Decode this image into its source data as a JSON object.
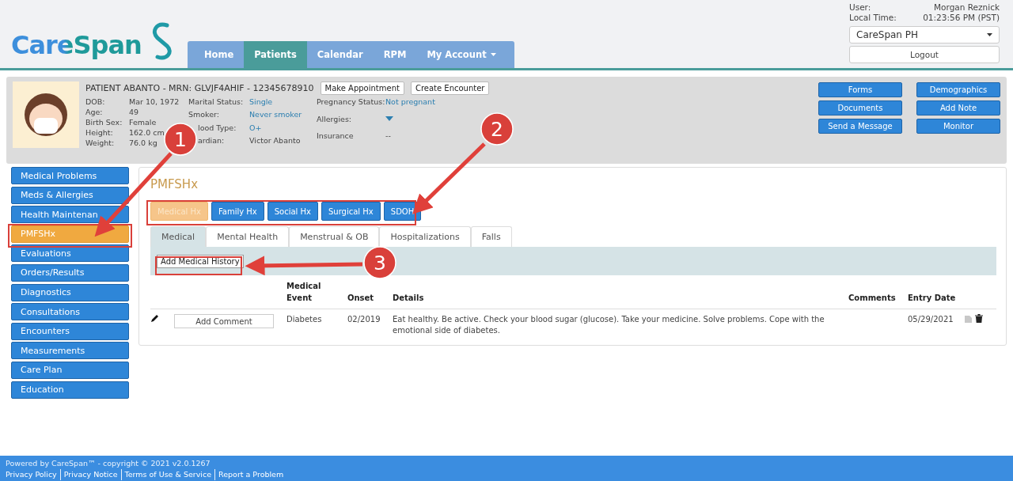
{
  "header": {
    "logo": "CareSpan",
    "nav": [
      {
        "label": "Home",
        "selected": false
      },
      {
        "label": "Patients",
        "selected": true
      },
      {
        "label": "Calendar",
        "selected": false
      },
      {
        "label": "RPM",
        "selected": false
      },
      {
        "label": "My Account",
        "selected": false,
        "kind": "menu"
      }
    ],
    "user_label": "User:",
    "user": "Morgan Reznick",
    "time_label": "Local Time:",
    "time": "01:23:56 PM (PST)",
    "org": "CareSpan PH",
    "logout": "Logout"
  },
  "patient": {
    "title": "PATIENT ABANTO - MRN: GLVJF4AHIF - 12345678910",
    "buttons": [
      "Make Appointment",
      "Create Encounter"
    ],
    "columns": [
      [
        {
          "label": "DOB:",
          "value": "Mar 10, 1972"
        },
        {
          "label": "Age:",
          "value": "49"
        },
        {
          "label": "Birth Sex:",
          "value": "Female"
        },
        {
          "label": "Height:",
          "value": "162.0 cm"
        },
        {
          "label": "Weight:",
          "value": "76.0 kg"
        }
      ],
      [
        {
          "label": "Marital Status:",
          "value": "Single",
          "kind": "link"
        },
        {
          "label": "Smoker:",
          "value": "Never smoker",
          "kind": "link"
        },
        {
          "label": "lood Type:",
          "value": "O+",
          "kind": "link",
          "covered": true
        },
        {
          "label": "ardian:",
          "value": "Victor Abanto",
          "covered": true
        }
      ],
      [
        {
          "label": "Pregnancy Status:",
          "value": "Not pregnant",
          "kind": "link"
        },
        {
          "label": "Allergies:",
          "kind": "caret"
        },
        {
          "label": "Insurance",
          "value": "--"
        }
      ]
    ],
    "actions": [
      [
        "Forms",
        "Demographics"
      ],
      [
        "Documents",
        "Add Note"
      ],
      [
        "Send a Message",
        "Monitor"
      ]
    ]
  },
  "sidebar": {
    "items": [
      {
        "label": "Medical Problems",
        "selected": false
      },
      {
        "label": "Meds & Allergies",
        "selected": false
      },
      {
        "label": "Health Maintenan",
        "selected": false
      },
      {
        "label": "PMFSHx",
        "selected": true
      },
      {
        "label": "Evaluations",
        "selected": false
      },
      {
        "label": "Orders/Results",
        "selected": false
      },
      {
        "label": "Diagnostics",
        "selected": false
      },
      {
        "label": "Consultations",
        "selected": false
      },
      {
        "label": "Encounters",
        "selected": false
      },
      {
        "label": "Measurements",
        "selected": false
      },
      {
        "label": "Care Plan",
        "selected": false
      },
      {
        "label": "Education",
        "selected": false
      }
    ]
  },
  "content": {
    "title": "PMFSHx",
    "tabs": [
      {
        "label": "Medical Hx",
        "selected": true
      },
      {
        "label": "Family Hx",
        "selected": false
      },
      {
        "label": "Social Hx",
        "selected": false
      },
      {
        "label": "Surgical Hx",
        "selected": false
      },
      {
        "label": "SDOH",
        "selected": false
      }
    ],
    "subtabs": [
      {
        "label": "Medical",
        "selected": true
      },
      {
        "label": "Mental Health",
        "selected": false
      },
      {
        "label": "Menstrual & OB",
        "selected": false
      },
      {
        "label": "Hospitalizations",
        "selected": false
      },
      {
        "label": "Falls",
        "selected": false
      }
    ],
    "add_button": "Add Medical History",
    "table": {
      "columns": [
        "Medical Event",
        "Onset",
        "Details",
        "Comments",
        "Entry Date"
      ],
      "rows": [
        {
          "comment_button": "Add Comment",
          "event": "Diabetes",
          "onset": "02/2019",
          "details": "Eat healthy. Be active. Check your blood sugar (glucose). Take your medicine. Solve problems. Cope with the emotional side of diabetes.",
          "entry_date": "05/29/2021"
        }
      ]
    }
  },
  "footer": {
    "powered": "Powered by CareSpan™ - copyright © 2021 v2.0.1267",
    "links": [
      "Privacy Policy",
      "Privacy Notice",
      "Terms of Use & Service",
      "Report a Problem"
    ]
  },
  "annotations": [
    {
      "number": "1"
    },
    {
      "number": "2"
    },
    {
      "number": "3"
    }
  ]
}
